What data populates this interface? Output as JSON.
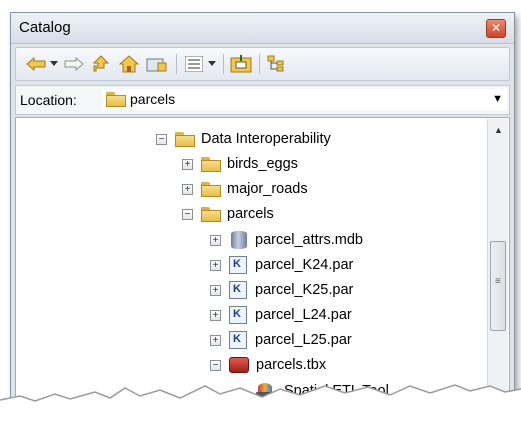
{
  "window": {
    "title": "Catalog"
  },
  "toolbar": {
    "icons": [
      "back-arrow-icon",
      "dropdown-arrow-icon",
      "forward-arrow-icon",
      "up-level-icon",
      "home-icon",
      "connect-folder-icon",
      "view-details-icon",
      "dropdown-arrow-icon",
      "new-item-icon",
      "toggle-contents-icon"
    ]
  },
  "location": {
    "label": "Location:",
    "value": "parcels"
  },
  "tree": {
    "rows": [
      {
        "label": "Data Interoperability",
        "expander": "−"
      },
      {
        "label": "birds_eggs",
        "expander": "+"
      },
      {
        "label": "major_roads",
        "expander": "+"
      },
      {
        "label": "parcels",
        "expander": "−"
      },
      {
        "label": "parcel_attrs.mdb",
        "expander": "+"
      },
      {
        "label": "parcel_K24.par",
        "expander": "+"
      },
      {
        "label": "parcel_K25.par",
        "expander": "+"
      },
      {
        "label": "parcel_L24.par",
        "expander": "+"
      },
      {
        "label": "parcel_L25.par",
        "expander": "+"
      },
      {
        "label": "parcels.tbx",
        "expander": "−"
      },
      {
        "label": "Spatial ETL Tool",
        "expander": ""
      }
    ]
  },
  "glyphs": {
    "close": "✕",
    "scroll_up": "▲",
    "loc_dropdown": "▼",
    "par_icon": "K",
    "grip": "≡"
  }
}
